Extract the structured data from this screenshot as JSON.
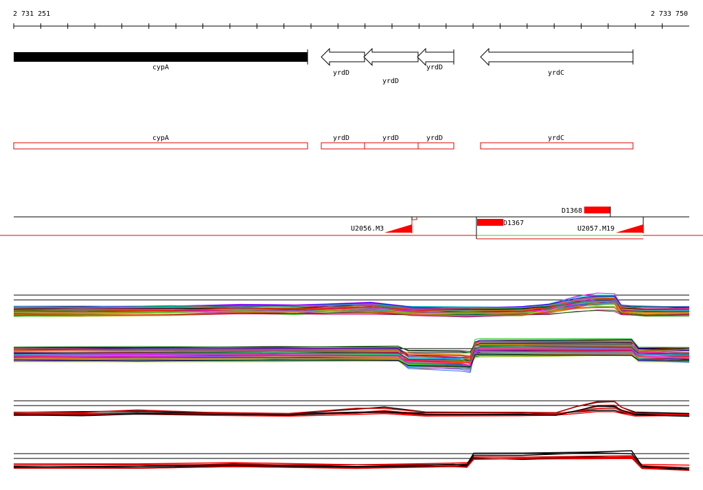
{
  "ruler": {
    "start_label": "2 731 251",
    "end_label": "2 733 750"
  },
  "genes": [
    {
      "name": "cypA",
      "strand": "+",
      "solid": true
    },
    {
      "name": "yrdD",
      "strand": "-"
    },
    {
      "name": "yrdD",
      "strand": "-"
    },
    {
      "name": "yrdD",
      "strand": "-"
    },
    {
      "name": "yrdC",
      "strand": "-"
    }
  ],
  "annotations": [
    {
      "name": "cypA"
    },
    {
      "name": "yrdD"
    },
    {
      "name": "yrdD"
    },
    {
      "name": "yrdD"
    },
    {
      "name": "yrdC"
    }
  ],
  "features": {
    "d1368": "D1368",
    "d1367": "D1367",
    "u2056": "U2056.M3",
    "u2057": "U2057.M19"
  },
  "colors": {
    "gene_solid": "#000000",
    "annotation_box": "#e00000",
    "feature_red": "#ff0000",
    "feature_green": "#33cc33"
  }
}
